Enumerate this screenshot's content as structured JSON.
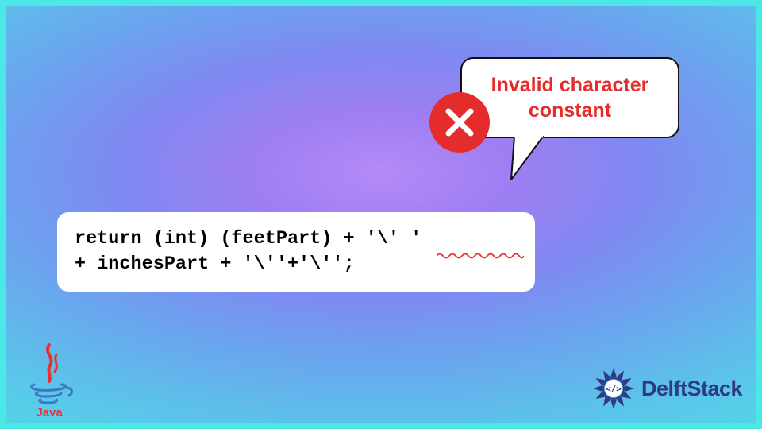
{
  "code": {
    "line1": "return (int) (feetPart) + '\\' '",
    "line2": "+ inchesPart + '\\''+'\\'';"
  },
  "tooltip": {
    "text": "Invalid character constant"
  },
  "logos": {
    "java_label": "Java",
    "delft_label": "DelftStack"
  },
  "colors": {
    "error_red": "#e52c2c",
    "delft_blue": "#2e3a82"
  }
}
